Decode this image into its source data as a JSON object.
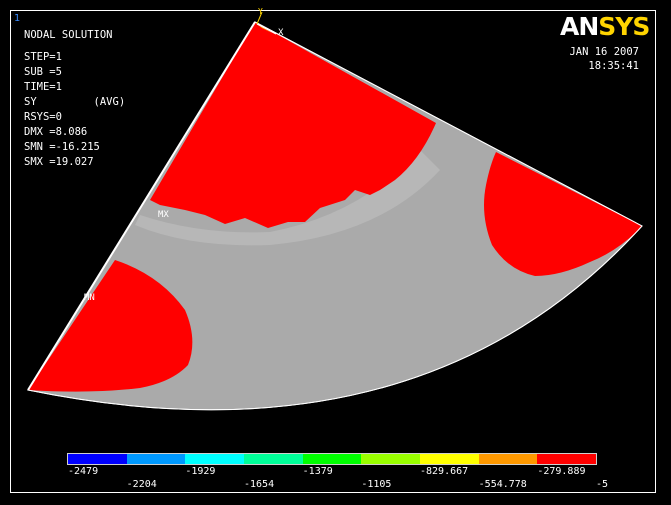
{
  "viewport_number": "1",
  "logo": {
    "part1": "AN",
    "part2": "SYS"
  },
  "timestamp": {
    "date": "JAN 16 2007",
    "time": "18:35:41"
  },
  "info": {
    "title": "NODAL SOLUTION",
    "step": "STEP=1",
    "sub": "SUB =5",
    "time": "TIME=1",
    "component": "SY         (AVG)",
    "rsys": "RSYS=0",
    "dmx": "DMX =8.086",
    "smn": "SMN =-16.215",
    "smx": "SMX =19.027"
  },
  "plot_labels": {
    "mx": "MX",
    "mn": "MN",
    "axis_x": "X",
    "axis_y": "Y"
  },
  "colors": {
    "contour_high": "#ff0000",
    "contour_low": "#aaaaaa",
    "legend": [
      "#0000ff",
      "#0099ff",
      "#00ffff",
      "#00ff99",
      "#00ff00",
      "#99ff00",
      "#ffff00",
      "#ff9900",
      "#ff0000"
    ]
  },
  "legend": {
    "top_labels": [
      "-2479",
      "-1929",
      "-1379",
      "-829.667",
      "-279.889"
    ],
    "bottom_labels": [
      "-2204",
      "-1654",
      "-1105",
      "-554.778",
      "-5"
    ]
  }
}
